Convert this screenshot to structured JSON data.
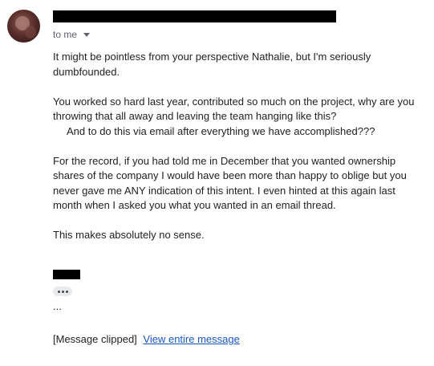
{
  "header": {
    "recipient_label": "to me"
  },
  "message": {
    "paragraphs": {
      "p1": "It might be pointless from your perspective Nathalie, but I'm seriously dumbfounded.",
      "p2_line1": "You worked so hard last year, contributed so much on the project, why are you throwing that all away and leaving the team hanging like this?",
      "p2_line2": "And to do this via email after everything we have accomplished???",
      "p3": "For the record, if you had told me in December that you wanted ownership shares of the company I would have been more than happy to oblige but you never gave me ANY indication of this intent.  I even hinted at this again last month when I asked you what you wanted in an email thread.",
      "p4": "This makes absolutely no sense."
    },
    "trailing_ellipsis": "..."
  },
  "footer": {
    "clipped_label": "[Message clipped]",
    "view_link_label": "View entire message"
  },
  "icons": {
    "recipient_dropdown": "chevron-down-icon",
    "show_trimmed": "more-horiz-icon"
  },
  "colors": {
    "link": "#1a57c2",
    "muted_text": "#5f6368",
    "body_text": "#222222",
    "trimmed_button_bg": "#e8eaed"
  }
}
